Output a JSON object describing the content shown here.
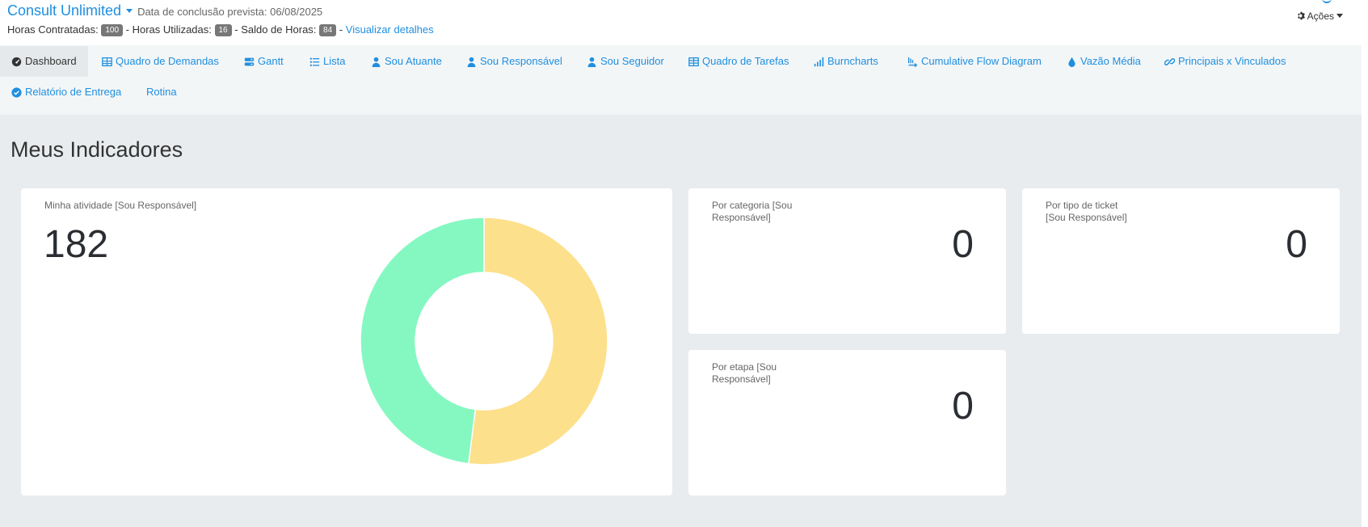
{
  "header": {
    "project_title": "Consult Unlimited",
    "due_date_text": "Data de conclusão prevista: 06/08/2025",
    "hours_contracted_label": "Horas Contratadas:",
    "hours_contracted": "100",
    "hours_used_label": "- Horas Utilizadas:",
    "hours_used": "16",
    "hours_balance_label": "- Saldo de Horas:",
    "hours_balance": "84",
    "separator": "-",
    "view_details_link": "Visualizar detalhes",
    "actions_label": "Ações"
  },
  "nav": {
    "tabs": [
      {
        "label": "Dashboard",
        "icon": "dashboard-icon"
      },
      {
        "label": "Quadro de Demandas",
        "icon": "table-icon"
      },
      {
        "label": "Gantt",
        "icon": "gantt-icon"
      },
      {
        "label": "Lista",
        "icon": "list-icon"
      },
      {
        "label": "Sou Atuante",
        "icon": "user-icon"
      },
      {
        "label": "Sou Responsável",
        "icon": "user-icon"
      },
      {
        "label": "Sou Seguidor",
        "icon": "user-icon"
      },
      {
        "label": "Quadro de Tarefas",
        "icon": "table-icon"
      },
      {
        "label": "Burncharts",
        "icon": "signal-icon"
      },
      {
        "label": "Cumulative Flow Diagram",
        "icon": "flow-icon"
      },
      {
        "label": "Vazão Média",
        "icon": "drop-icon"
      },
      {
        "label": "Principais x Vinculados",
        "icon": "link-icon"
      },
      {
        "label": "Relatório de Entrega",
        "icon": "check-circle-icon"
      },
      {
        "label": "Rotina",
        "icon": ""
      }
    ],
    "active": "Dashboard"
  },
  "main": {
    "title": "Meus Indicadores",
    "cards": [
      {
        "label": "Minha atividade [Sou Responsável]",
        "value": "182"
      },
      {
        "label_line1": "Por categoria [Sou",
        "label_line2": "Responsável]",
        "value": "0"
      },
      {
        "label_line1": "Por tipo de ticket",
        "label_line2": "[Sou Responsável]",
        "value": "0"
      },
      {
        "label_line1": "Por etapa [Sou",
        "label_line2": "Responsável]",
        "value": "0"
      }
    ]
  },
  "chart_data": {
    "type": "pie",
    "variant": "donut",
    "values": [
      52,
      48
    ],
    "colors": [
      "#fde08b",
      "#85f8c1"
    ]
  },
  "colors": {
    "link": "#1f8fe0",
    "badge": "#777777",
    "content_bg": "#e9ecee",
    "nav_bg": "#f3f6f7"
  }
}
